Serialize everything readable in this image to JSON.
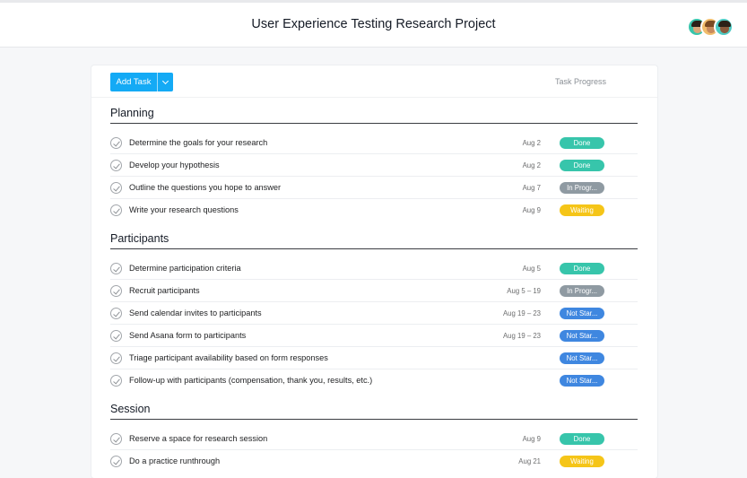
{
  "header": {
    "title": "User Experience Testing Research Project"
  },
  "toolbar": {
    "add_task_label": "Add Task",
    "progress_column_label": "Task Progress"
  },
  "status_colors": {
    "Done": "#37c5ab",
    "In Progr...": "#8f9aa2",
    "Waiting": "#f5c518",
    "Not Star...": "#3f87e0"
  },
  "sections": [
    {
      "title": "Planning",
      "tasks": [
        {
          "name": "Determine the goals for your research",
          "date": "Aug 2",
          "status": "Done"
        },
        {
          "name": "Develop your hypothesis",
          "date": "Aug 2",
          "status": "Done"
        },
        {
          "name": "Outline the questions you hope to answer",
          "date": "Aug 7",
          "status": "In Progr..."
        },
        {
          "name": "Write your research questions",
          "date": "Aug 9",
          "status": "Waiting"
        }
      ]
    },
    {
      "title": "Participants",
      "tasks": [
        {
          "name": "Determine participation criteria",
          "date": "Aug 5",
          "status": "Done"
        },
        {
          "name": "Recruit participants",
          "date": "Aug 5 – 19",
          "status": "In Progr..."
        },
        {
          "name": "Send calendar invites to participants",
          "date": "Aug 19 – 23",
          "status": "Not Star..."
        },
        {
          "name": "Send Asana form to participants",
          "date": "Aug 19 – 23",
          "status": "Not Star..."
        },
        {
          "name": "Triage participant availability based on form responses",
          "date": "",
          "status": "Not Star..."
        },
        {
          "name": "Follow-up with participants (compensation, thank you, results, etc.)",
          "date": "",
          "status": "Not Star..."
        }
      ]
    },
    {
      "title": "Session",
      "tasks": [
        {
          "name": "Reserve a space for research session",
          "date": "Aug 9",
          "status": "Done"
        },
        {
          "name": "Do a practice runthrough",
          "date": "Aug 21",
          "status": "Waiting"
        }
      ]
    }
  ]
}
